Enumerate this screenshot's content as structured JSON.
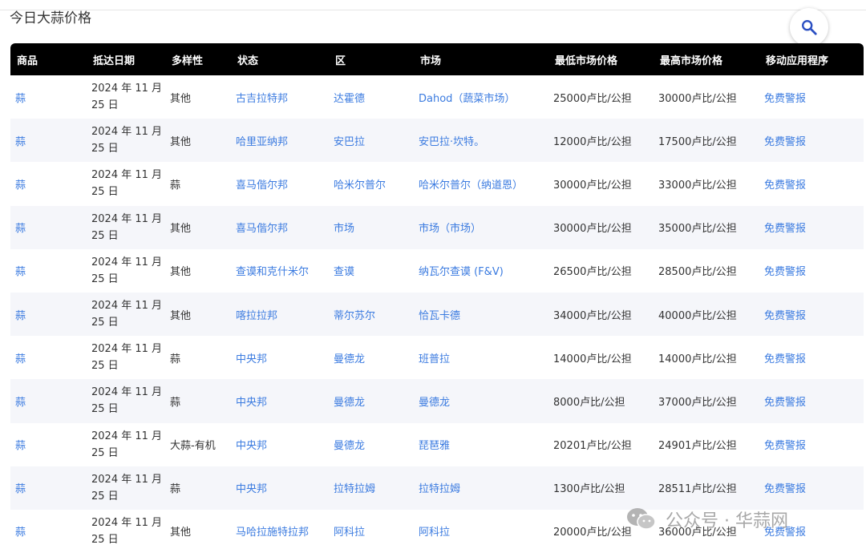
{
  "page": {
    "title": "今日大蒜价格"
  },
  "table": {
    "headers": [
      "商品",
      "抵达日期",
      "多样性",
      "状态",
      "区",
      "市场",
      "最低市场价格",
      "最高市场价格",
      "移动应用程序"
    ],
    "rows": [
      {
        "commodity": "蒜",
        "date_line1": "2024 年 11 月",
        "date_line2": "25 日",
        "variety": "其他",
        "state": "古吉拉特邦",
        "district": "达霍德",
        "market": "Dahod（蔬菜市场）",
        "min_price": "25000卢比/公担",
        "max_price": "30000卢比/公担",
        "app": "免费警报"
      },
      {
        "commodity": "蒜",
        "date_line1": "2024 年 11 月",
        "date_line2": "25 日",
        "variety": "其他",
        "state": "哈里亚纳邦",
        "district": "安巴拉",
        "market": "安巴拉·坎特。",
        "min_price": "12000卢比/公担",
        "max_price": "17500卢比/公担",
        "app": "免费警报"
      },
      {
        "commodity": "蒜",
        "date_line1": "2024 年 11 月",
        "date_line2": "25 日",
        "variety": "蒜",
        "state": "喜马偕尔邦",
        "district": "哈米尔普尔",
        "market": "哈米尔普尔（纳道恩）",
        "min_price": "30000卢比/公担",
        "max_price": "33000卢比/公担",
        "app": "免费警报"
      },
      {
        "commodity": "蒜",
        "date_line1": "2024 年 11 月",
        "date_line2": "25 日",
        "variety": "其他",
        "state": "喜马偕尔邦",
        "district": "市场",
        "market": "市场（市场）",
        "min_price": "30000卢比/公担",
        "max_price": "35000卢比/公担",
        "app": "免费警报"
      },
      {
        "commodity": "蒜",
        "date_line1": "2024 年 11 月",
        "date_line2": "25 日",
        "variety": "其他",
        "state": "查谟和克什米尔",
        "district": "查谟",
        "market": "纳瓦尔查谟 (F&V)",
        "min_price": "26500卢比/公担",
        "max_price": "28500卢比/公担",
        "app": "免费警报"
      },
      {
        "commodity": "蒜",
        "date_line1": "2024 年 11 月",
        "date_line2": "25 日",
        "variety": "其他",
        "state": "喀拉拉邦",
        "district": "蒂尔苏尔",
        "market": "恰瓦卡德",
        "min_price": "34000卢比/公担",
        "max_price": "40000卢比/公担",
        "app": "免费警报"
      },
      {
        "commodity": "蒜",
        "date_line1": "2024 年 11 月",
        "date_line2": "25 日",
        "variety": "蒜",
        "state": "中央邦",
        "district": "曼德龙",
        "market": "班普拉",
        "min_price": "14000卢比/公担",
        "max_price": "14000卢比/公担",
        "app": "免费警报"
      },
      {
        "commodity": "蒜",
        "date_line1": "2024 年 11 月",
        "date_line2": "25 日",
        "variety": "蒜",
        "state": "中央邦",
        "district": "曼德龙",
        "market": "曼德龙",
        "min_price": "8000卢比/公担",
        "max_price": "37000卢比/公担",
        "app": "免费警报"
      },
      {
        "commodity": "蒜",
        "date_line1": "2024 年 11 月",
        "date_line2": "25 日",
        "variety": "大蒜-有机",
        "state": "中央邦",
        "district": "曼德龙",
        "market": "琵琶雅",
        "min_price": "20201卢比/公担",
        "max_price": "24901卢比/公担",
        "app": "免费警报"
      },
      {
        "commodity": "蒜",
        "date_line1": "2024 年 11 月",
        "date_line2": "25 日",
        "variety": "蒜",
        "state": "中央邦",
        "district": "拉特拉姆",
        "market": "拉特拉姆",
        "min_price": "1300卢比/公担",
        "max_price": "28511卢比/公担",
        "app": "免费警报"
      },
      {
        "commodity": "蒜",
        "date_line1": "2024 年 11 月",
        "date_line2": "25 日",
        "variety": "其他",
        "state": "马哈拉施特拉邦",
        "district": "阿科拉",
        "market": "阿科拉",
        "min_price": "20000卢比/公担",
        "max_price": "36000卢比/公担",
        "app": "免费警报"
      }
    ]
  },
  "watermark": {
    "text": "公众号 · 华蒜网"
  },
  "icons": {
    "search": "search-icon",
    "wechat": "wechat-icon"
  },
  "colors": {
    "link": "#3b7be0",
    "header_bg": "#000000",
    "stripe": "#f5f6fa"
  }
}
